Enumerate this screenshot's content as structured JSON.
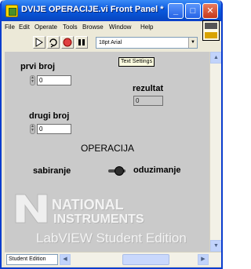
{
  "window": {
    "title": "DVIJE OPERACIJE.vi Front Panel *",
    "controls": {
      "minimize": "_",
      "maximize": "□",
      "close": "✕"
    }
  },
  "menu": [
    "File",
    "Edit",
    "Operate",
    "Tools",
    "Browse",
    "Window",
    "Help"
  ],
  "toolbar": {
    "font_select": "18pt Arial",
    "icons": [
      "run-arrow-icon",
      "run-continuous-icon",
      "abort-icon",
      "pause-icon"
    ]
  },
  "panel": {
    "tooltip": "Text Settings",
    "prvi_broj": {
      "label": "prvi broj",
      "value": "0"
    },
    "drugi_broj": {
      "label": "drugi broj",
      "value": "0"
    },
    "rezultat": {
      "label": "rezultat",
      "value": "0"
    },
    "operacija": {
      "heading": "OPERACIJA",
      "left_label": "sabiranje",
      "right_label": "oduzimanje"
    },
    "watermark": {
      "line1": "NATIONAL",
      "line2": "INSTRUMENTS",
      "line3": "LabVIEW Student Edition"
    }
  },
  "statusbar": {
    "label": "Student Edition"
  },
  "colors": {
    "titlebar": "#0a5ae0",
    "panel_bg": "#cacaca",
    "chrome": "#ece9d8"
  }
}
